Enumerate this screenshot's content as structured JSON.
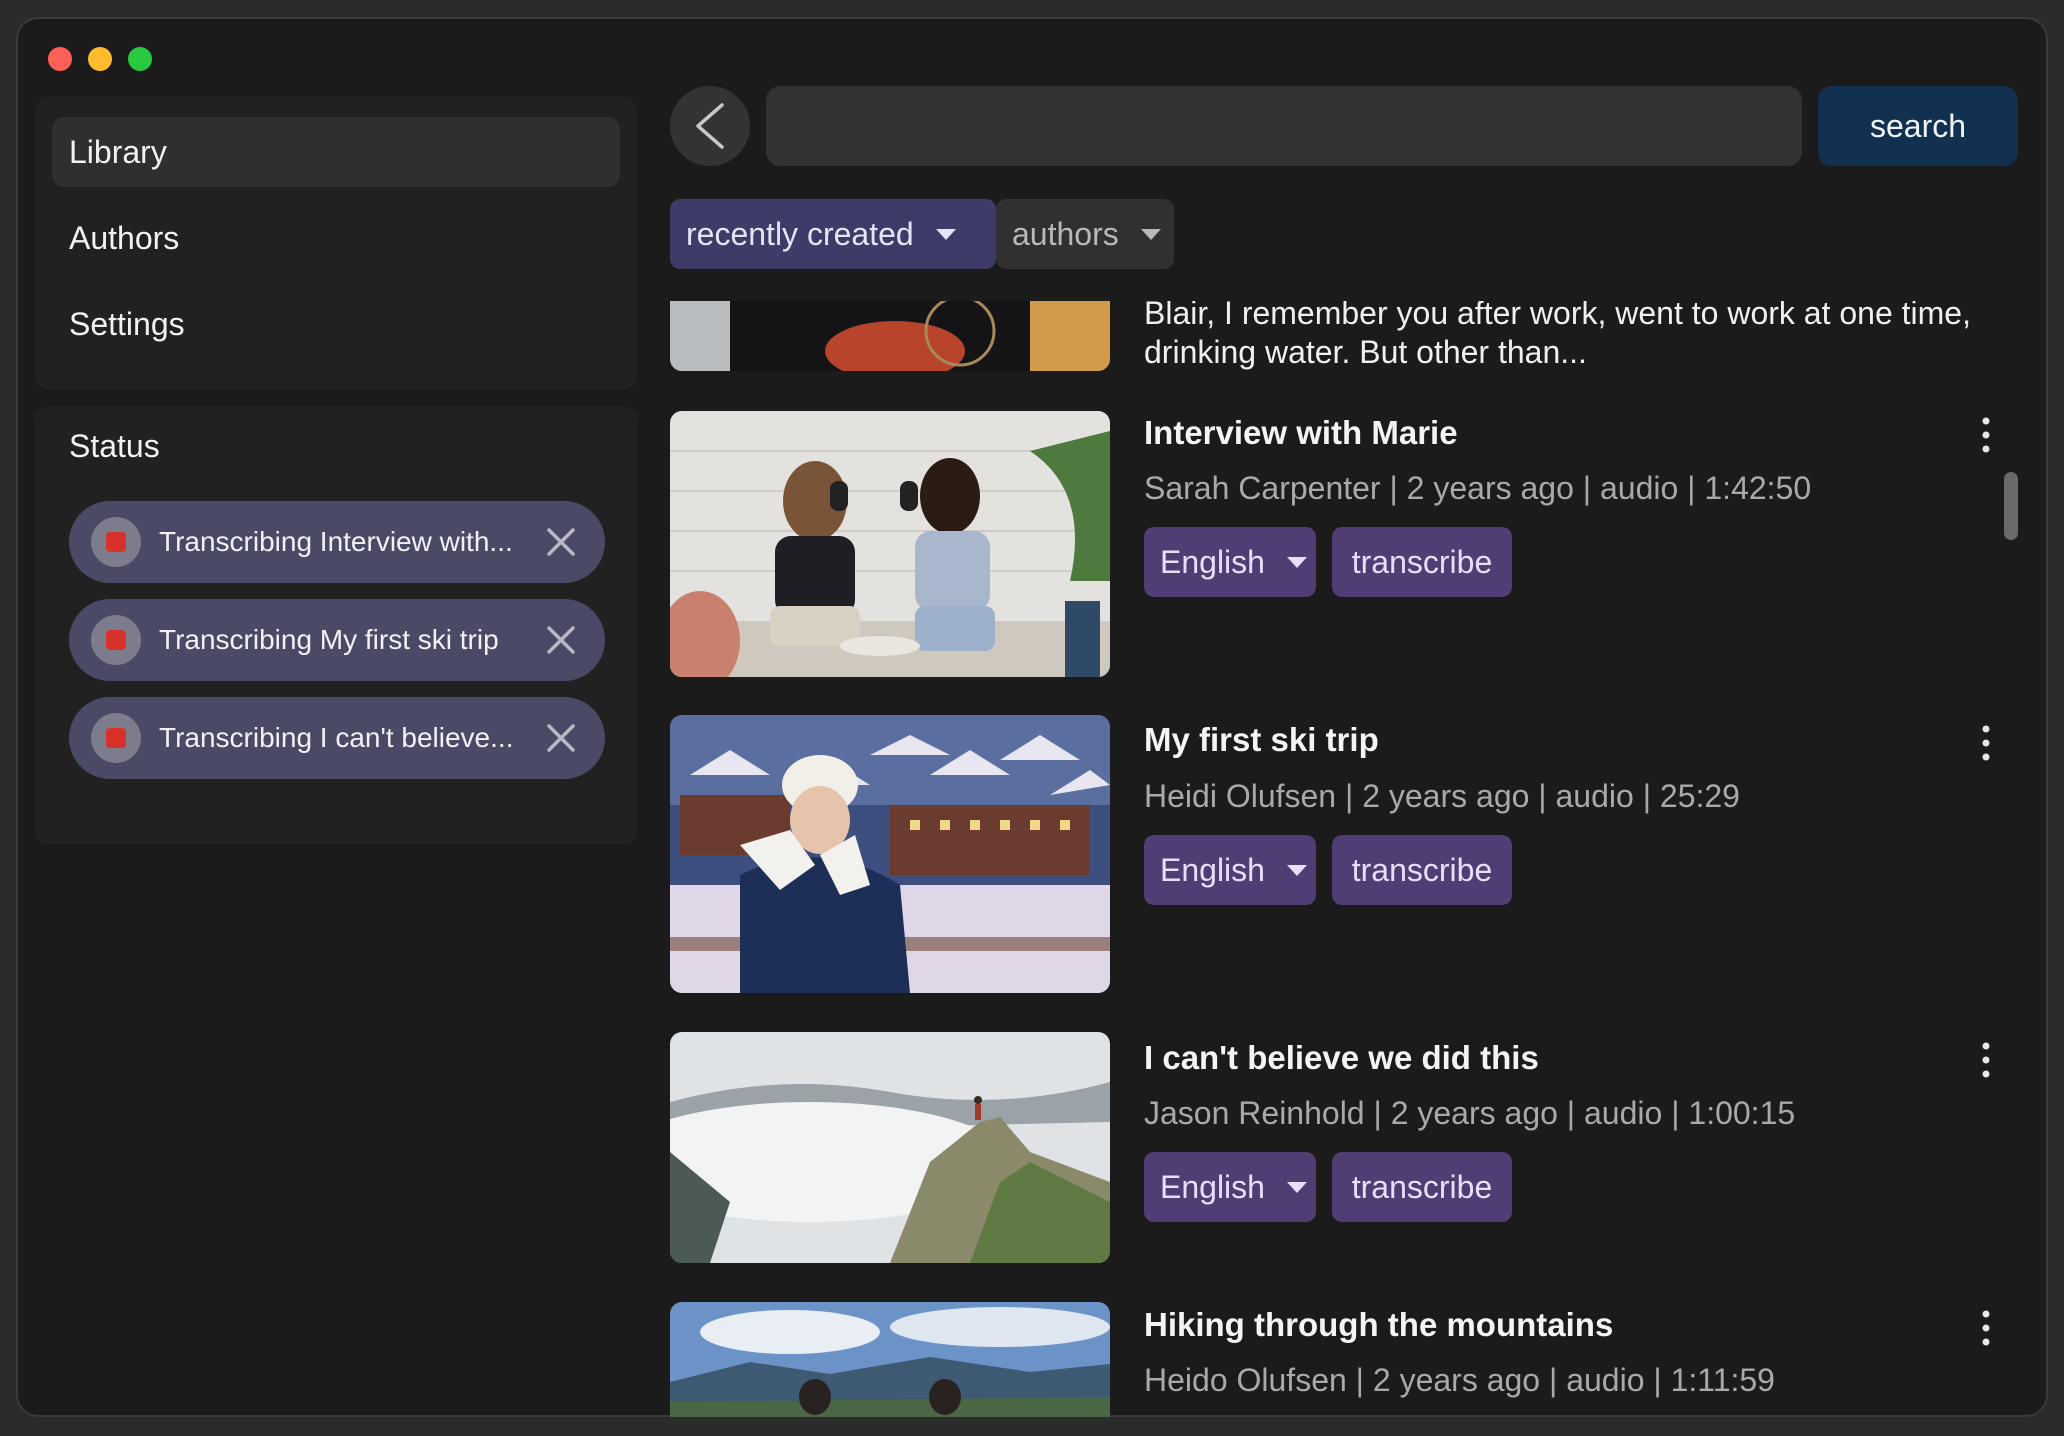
{
  "sidebar": {
    "nav": [
      {
        "label": "Library",
        "active": true
      },
      {
        "label": "Authors",
        "active": false
      },
      {
        "label": "Settings",
        "active": false
      }
    ],
    "status_title": "Status",
    "tasks": [
      {
        "label": "Transcribing Interview with..."
      },
      {
        "label": "Transcribing My first ski trip"
      },
      {
        "label": "Transcribing I can't believe..."
      }
    ]
  },
  "topbar": {
    "back_icon": "chevron-left-icon",
    "search_value": "",
    "search_label": "search"
  },
  "filters": {
    "sort_label": "recently created",
    "authors_label": "authors"
  },
  "items": [
    {
      "snippet_line1": "Blair, I remember you after work, went to work at one time,",
      "snippet_line2": "drinking water. But other than..."
    },
    {
      "title": "Interview with Marie",
      "meta": "Sarah Carpenter | 2 years ago | audio | 1:42:50",
      "language": "English",
      "action": "transcribe"
    },
    {
      "title": "My first ski trip",
      "meta": "Heidi Olufsen | 2 years ago | audio | 25:29",
      "language": "English",
      "action": "transcribe"
    },
    {
      "title": "I can't believe we did this",
      "meta": "Jason Reinhold | 2 years ago | audio | 1:00:15",
      "language": "English",
      "action": "transcribe"
    },
    {
      "title": "Hiking through the mountains",
      "meta": "Heido Olufsen | 2 years ago | audio | 1:11:59"
    }
  ],
  "colors": {
    "window_bg": "#1b1b1c",
    "panel_bg": "#212122",
    "chip_bg": "#4b4a66",
    "sort_filter_bg": "#3d3b68",
    "search_button_bg": "#12304f",
    "tag_bg": "#4f3d74",
    "stop_red": "#d8312b"
  }
}
